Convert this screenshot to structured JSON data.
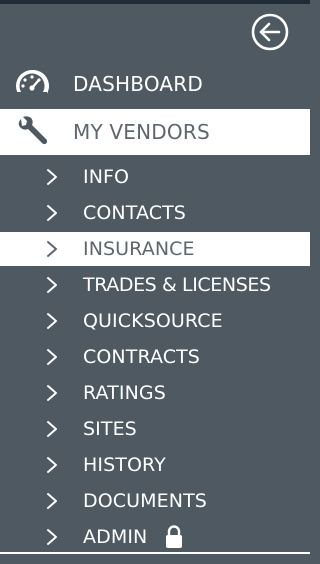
{
  "colors": {
    "panel_bg": "#4e5961",
    "top_bar": "#1f2b36",
    "active_bg": "#ffffff",
    "active_text": "#5e676e",
    "text": "#ffffff"
  },
  "header": {
    "back_icon": "arrow-left-circle-icon"
  },
  "nav": {
    "dashboard": {
      "label": "DASHBOARD",
      "icon": "speedometer-icon"
    },
    "my_vendors": {
      "label": "MY VENDORS",
      "icon": "wrench-icon",
      "active": true
    },
    "submenu": [
      {
        "label": "INFO"
      },
      {
        "label": "CONTACTS"
      },
      {
        "label": "INSURANCE",
        "active": true
      },
      {
        "label": "TRADES & LICENSES"
      },
      {
        "label": "QUICKSOURCE"
      },
      {
        "label": "CONTRACTS"
      },
      {
        "label": "RATINGS"
      },
      {
        "label": "SITES"
      },
      {
        "label": "HISTORY"
      },
      {
        "label": "DOCUMENTS"
      },
      {
        "label": "ADMIN",
        "icon": "lock-icon"
      }
    ]
  }
}
